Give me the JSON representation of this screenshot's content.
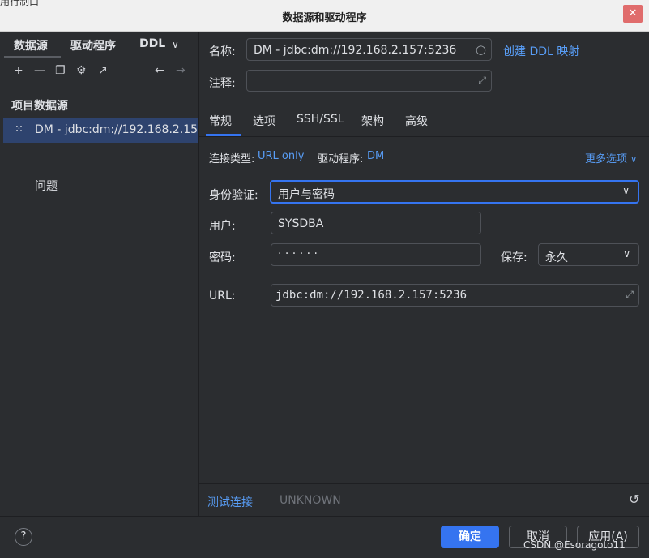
{
  "window": {
    "title": "数据源和驱动程序",
    "title_fragment": "用行制口",
    "close": "✕"
  },
  "left": {
    "tabs": [
      "数据源",
      "驱动程序",
      "DDL"
    ],
    "tab_more": "∨",
    "toolbar_icons": [
      "add-icon",
      "remove-icon",
      "copy-icon",
      "settings-icon",
      "open-external-icon",
      "back-arrow-icon",
      "forward-arrow-icon"
    ],
    "toolbar_glyphs": {
      "add": "+",
      "remove": "—",
      "copy": "❐",
      "settings": "⚙",
      "open": "↗",
      "back": "←",
      "forward": "→"
    },
    "section_title": "项目数据源",
    "datasource": {
      "icon": "⁙",
      "label": "DM - jdbc:dm://192.168.2.157:5236"
    },
    "problems": "问题"
  },
  "form": {
    "name_label": "名称:",
    "name_value": "DM - jdbc:dm://192.168.2.157:5236",
    "create_ddl_link": "创建 DDL 映射",
    "comment_label": "注释:",
    "comment_value": "",
    "tabs": [
      "常规",
      "选项",
      "SSH/SSL",
      "架构",
      "高级"
    ],
    "active_tab": "常规",
    "conn_type_label": "连接类型:",
    "conn_type_value": "URL only",
    "driver_label": "驱动程序:",
    "driver_value": "DM",
    "more_options": "更多选项",
    "auth_label": "身份验证:",
    "auth_value": "用户与密码",
    "user_label": "用户:",
    "user_value": "SYSDBA",
    "password_label": "密码:",
    "password_value": "· · · · · ·",
    "save_label": "保存:",
    "save_value": "永久",
    "url_label": "URL:",
    "url_value": "jdbc:dm://192.168.2.157:5236",
    "expand_glyph": "⤢",
    "clear_glyph": "○",
    "chevron_glyph": "∨"
  },
  "test": {
    "link": "测试连接",
    "status": "UNKNOWN",
    "reset_glyph": "↺"
  },
  "footer": {
    "help": "?",
    "ok": "确定",
    "cancel": "取消",
    "apply": "应用(A)"
  },
  "watermark": "CSDN @Esoragoto11",
  "colors": {
    "accent": "#3574f0",
    "link": "#589df6",
    "selection": "#2e436e",
    "background": "#2b2d30"
  }
}
